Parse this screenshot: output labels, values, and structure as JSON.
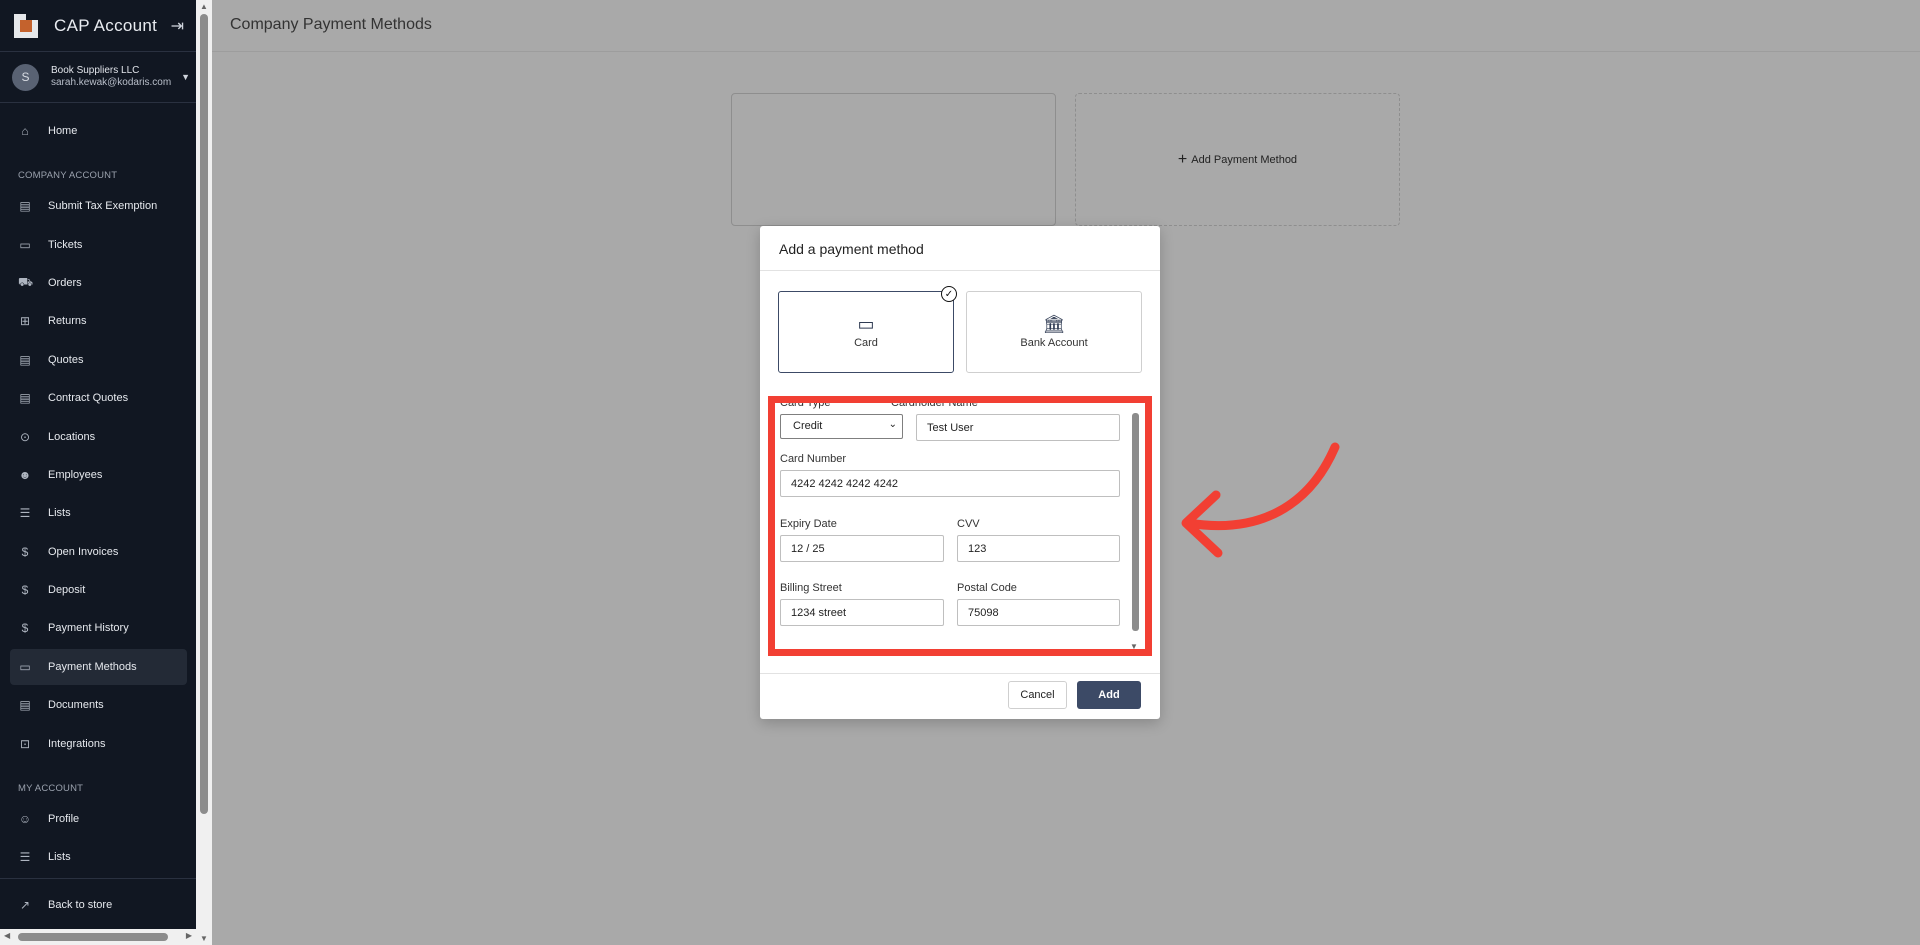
{
  "app": {
    "title": "CAP Account"
  },
  "account": {
    "initial": "S",
    "company": "Book Suppliers LLC",
    "email": "sarah.kewak@kodaris.com"
  },
  "sidebar": {
    "home": "Home",
    "section_company": "COMPANY ACCOUNT",
    "company_items": [
      "Submit Tax Exemption",
      "Tickets",
      "Orders",
      "Returns",
      "Quotes",
      "Contract Quotes",
      "Locations",
      "Employees",
      "Lists",
      "Open Invoices",
      "Deposit",
      "Payment History",
      "Payment Methods",
      "Documents",
      "Integrations"
    ],
    "section_my": "MY ACCOUNT",
    "my_items": [
      "Profile",
      "Lists"
    ],
    "back": "Back to store"
  },
  "page": {
    "title": "Company Payment Methods",
    "add_method": "Add Payment Method"
  },
  "modal": {
    "title": "Add a payment method",
    "type_card": "Card",
    "type_bank": "Bank Account",
    "fields": {
      "card_type_label": "Card Type",
      "card_type_value": "Credit",
      "cardholder_label": "Cardholder Name",
      "cardholder_value": "Test User",
      "card_number_label": "Card Number",
      "card_number_value": "4242 4242 4242 4242",
      "expiry_label": "Expiry Date",
      "expiry_value": "12 / 25",
      "cvv_label": "CVV",
      "cvv_value": "123",
      "street_label": "Billing Street",
      "street_value": "1234 street",
      "postal_label": "Postal Code",
      "postal_value": "75098"
    },
    "cancel": "Cancel",
    "add": "Add"
  },
  "colors": {
    "sidebar_bg": "#111722",
    "accent": "#3c4a66",
    "highlight": "#f23f33"
  }
}
